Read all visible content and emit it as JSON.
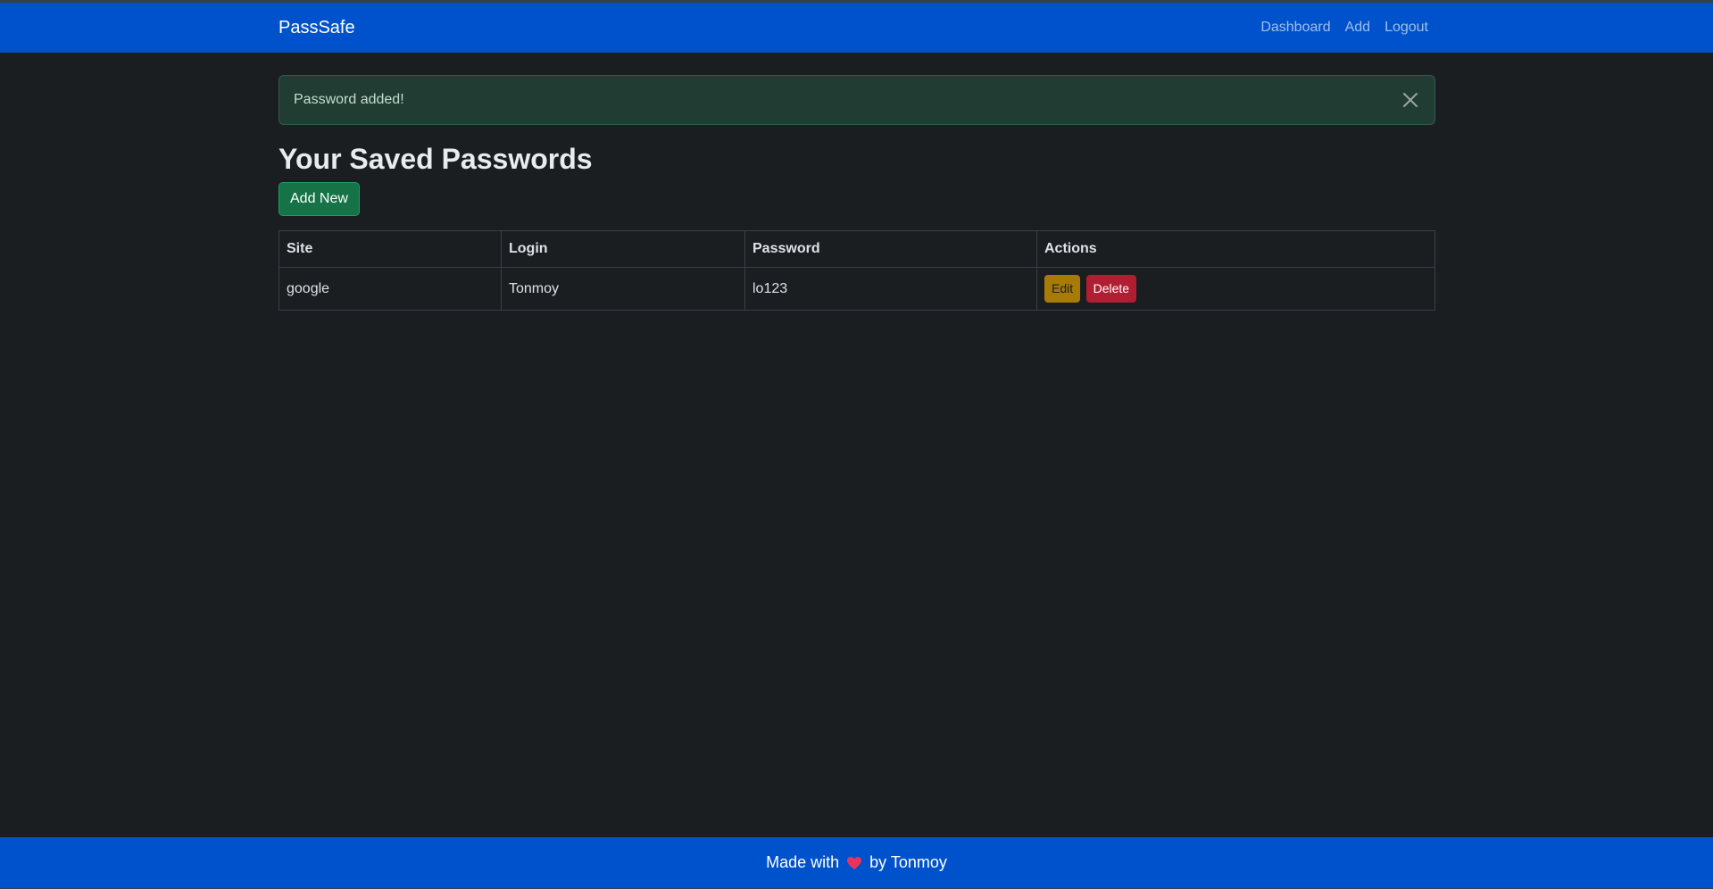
{
  "app": {
    "brand": "PassSafe"
  },
  "nav": {
    "items": [
      {
        "label": "Dashboard"
      },
      {
        "label": "Add"
      },
      {
        "label": "Logout"
      }
    ]
  },
  "alert": {
    "message": "Password added!",
    "close_icon": "close-icon"
  },
  "main": {
    "title": "Your Saved Passwords",
    "add_button": "Add New"
  },
  "table": {
    "headers": [
      "Site",
      "Login",
      "Password",
      "Actions"
    ],
    "rows": [
      {
        "site": "google",
        "login": "Tonmoy",
        "password": "lo123",
        "edit_label": "Edit",
        "delete_label": "Delete"
      }
    ]
  },
  "footer": {
    "prefix": "Made with",
    "icon": "heart-icon",
    "suffix": "by Tonmoy"
  },
  "colors": {
    "navbar": "#0052cc",
    "background": "#1b1e21",
    "alert_bg": "#213c33",
    "success_button": "#157347",
    "warning_button": "#a87b07",
    "danger_button": "#b01e32",
    "heart": "#e8345a"
  }
}
